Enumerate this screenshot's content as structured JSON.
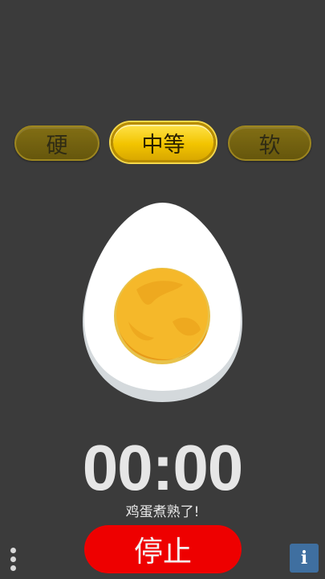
{
  "tabs": [
    {
      "label": "硬",
      "selected": false
    },
    {
      "label": "中等",
      "selected": true
    },
    {
      "label": "软",
      "selected": false
    }
  ],
  "timer": {
    "display": "00:00"
  },
  "status": {
    "message": "鸡蛋煮熟了!"
  },
  "controls": {
    "stop_label": "停止",
    "menu_icon": "vertical-dots-icon",
    "info_icon": "info-icon",
    "info_label": "i"
  },
  "colors": {
    "background": "#3b3b3b",
    "tab_selected": "#f2c400",
    "tab_unselected": "#7a660c",
    "stop_button": "#ee0000",
    "info_button": "#3f6fa0",
    "yolk": "#f5b82a"
  }
}
